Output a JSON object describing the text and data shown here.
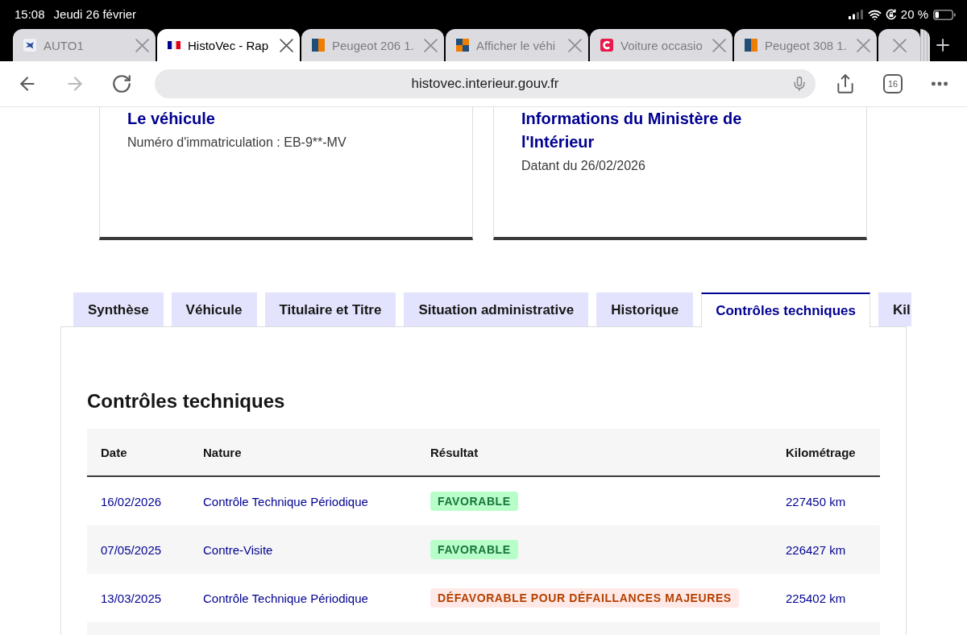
{
  "status_bar": {
    "time": "15:08",
    "date": "Jeudi 26 février",
    "battery": "20 %"
  },
  "browser_tabs": [
    {
      "kind": "logo",
      "title": "AUTO1",
      "selected": false
    },
    {
      "kind": "flag",
      "title": "HistoVec - Rap",
      "selected": true
    },
    {
      "kind": "split",
      "title": "Peugeot 206 1.",
      "selected": false
    },
    {
      "kind": "quartered",
      "title": "Afficher le véhi",
      "selected": false
    },
    {
      "kind": "arc",
      "title": "Voiture occasio",
      "selected": false
    },
    {
      "kind": "split",
      "title": "Peugeot 308 1.",
      "selected": false
    },
    {
      "kind": "blank",
      "selected": false
    }
  ],
  "toolbar": {
    "back_disabled": false,
    "forward_disabled": true,
    "url": "histovec.interieur.gouv.fr",
    "tab_count": "16"
  },
  "cards": [
    {
      "title": "Le véhicule",
      "text": "Numéro d'immatriculation : EB-9**-MV"
    },
    {
      "title": "Informations du Ministère de l'Intérieur",
      "text": "Datant du 26/02/2026"
    }
  ],
  "report_tabs": [
    {
      "label": "Synthèse",
      "selected": false
    },
    {
      "label": "Véhicule",
      "selected": false
    },
    {
      "label": "Titulaire et Titre",
      "selected": false
    },
    {
      "label": "Situation administrative",
      "selected": false
    },
    {
      "label": "Historique",
      "selected": false
    },
    {
      "label": "Contrôles techniques",
      "selected": true
    },
    {
      "label": "Kil",
      "selected": false
    }
  ],
  "section": {
    "title": "Contrôles techniques",
    "table": {
      "columns": [
        "Date",
        "Nature",
        "Résultat",
        "Kilométrage"
      ],
      "rows": [
        {
          "date": "16/02/2026",
          "nature": "Contrôle Technique Périodique",
          "result": {
            "text": "FAVORABLE",
            "kind": "success"
          },
          "mileage": "227450 km"
        },
        {
          "date": "07/05/2025",
          "nature": "Contre-Visite",
          "result": {
            "text": "FAVORABLE",
            "kind": "success"
          },
          "mileage": "226427 km"
        },
        {
          "date": "13/03/2025",
          "nature": "Contrôle Technique Périodique",
          "result": {
            "text": "DÉFAVORABLE POUR DÉFAILLANCES MAJEURES",
            "kind": "error"
          },
          "mileage": "225402 km"
        }
      ]
    }
  }
}
